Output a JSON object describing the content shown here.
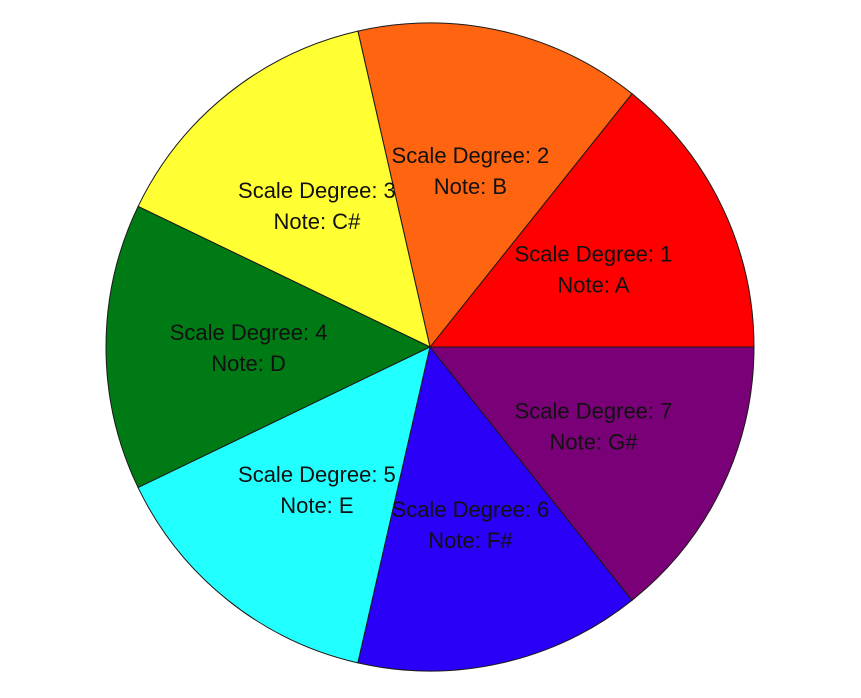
{
  "chart_data": {
    "type": "pie",
    "title": "",
    "start_angle_deg": 0,
    "direction": "counterclockwise",
    "slices": [
      {
        "value": 1,
        "line1": "Scale Degree: 1",
        "line2": "Note: A",
        "color": "#ff0000"
      },
      {
        "value": 1,
        "line1": "Scale Degree: 2",
        "line2": "Note: B",
        "color": "#ff6410"
      },
      {
        "value": 1,
        "line1": "Scale Degree: 3",
        "line2": "Note: C#",
        "color": "#ffff33"
      },
      {
        "value": 1,
        "line1": "Scale Degree: 4",
        "line2": "Note: D",
        "color": "#007a14"
      },
      {
        "value": 1,
        "line1": "Scale Degree: 5",
        "line2": "Note: E",
        "color": "#22ffff"
      },
      {
        "value": 1,
        "line1": "Scale Degree: 6",
        "line2": "Note: F#",
        "color": "#2a00f6"
      },
      {
        "value": 1,
        "line1": "Scale Degree: 7",
        "line2": "Note: G#",
        "color": "#7a0078"
      }
    ]
  }
}
